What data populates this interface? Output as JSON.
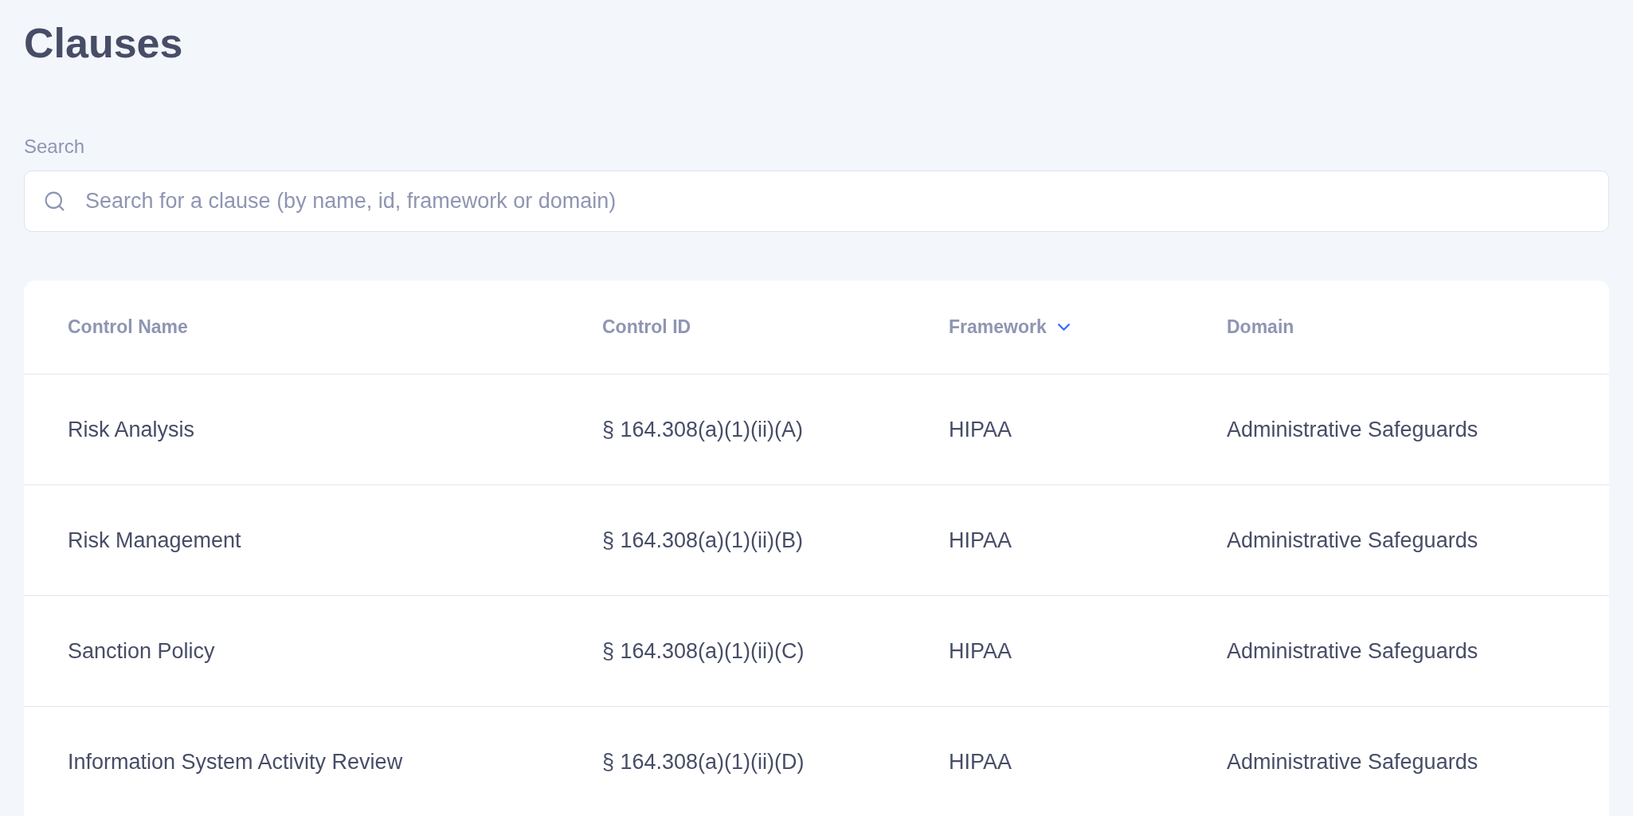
{
  "page": {
    "title": "Clauses"
  },
  "search": {
    "label": "Search",
    "placeholder": "Search for a clause (by name, id, framework or domain)"
  },
  "table": {
    "columns": [
      {
        "label": "Control Name",
        "sorted": false
      },
      {
        "label": "Control ID",
        "sorted": false
      },
      {
        "label": "Framework",
        "sorted": true
      },
      {
        "label": "Domain",
        "sorted": false
      }
    ],
    "rows": [
      {
        "cells": [
          "Risk Analysis",
          "§ 164.308(a)(1)(ii)(A)",
          "HIPAA",
          "Administrative Safeguards"
        ]
      },
      {
        "cells": [
          "Risk Management",
          "§ 164.308(a)(1)(ii)(B)",
          "HIPAA",
          "Administrative Safeguards"
        ]
      },
      {
        "cells": [
          "Sanction Policy",
          "§ 164.308(a)(1)(ii)(C)",
          "HIPAA",
          "Administrative Safeguards"
        ]
      },
      {
        "cells": [
          "Information System Activity Review",
          "§ 164.308(a)(1)(ii)(D)",
          "HIPAA",
          "Administrative Safeguards"
        ]
      }
    ]
  }
}
